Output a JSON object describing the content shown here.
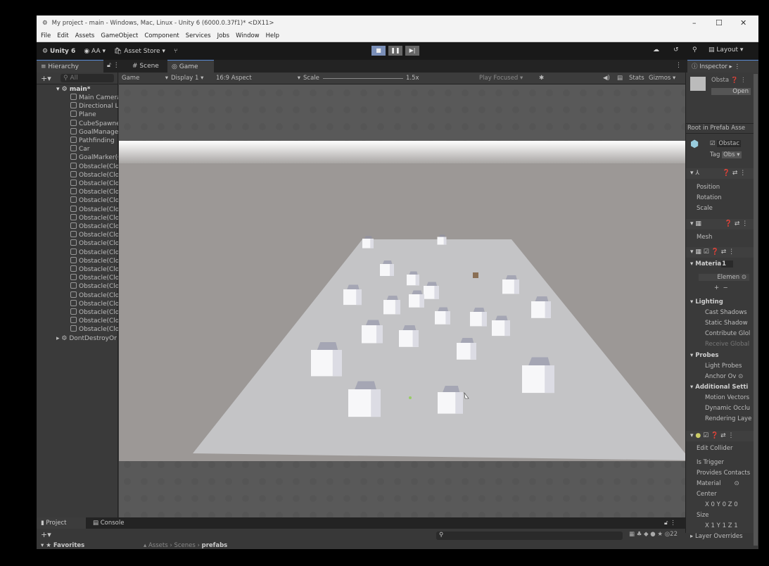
{
  "window": {
    "title": "My project - main - Windows, Mac, Linux - Unity 6 (6000.0.37f1)* <DX11>"
  },
  "menu": [
    "File",
    "Edit",
    "Assets",
    "GameObject",
    "Component",
    "Services",
    "Jobs",
    "Window",
    "Help"
  ],
  "toolbar": {
    "unity": "Unity 6",
    "account": "AA",
    "asset_store": "Asset Store",
    "layout": "Layout",
    "play_mode": "playing"
  },
  "tabs": {
    "hierarchy": "Hierarchy",
    "scene": "Scene",
    "game": "Game",
    "inspector": "Inspector"
  },
  "hierarchy": {
    "search_placeholder": "All",
    "scene": "main*",
    "items": [
      "Main Camera",
      "Directional Light",
      "Plane",
      "CubeSpawner",
      "GoalManager",
      "Pathfinding",
      "Car",
      "GoalMarker(Clone)",
      "Obstacle(Clone)",
      "Obstacle(Clone)",
      "Obstacle(Clone)",
      "Obstacle(Clone)",
      "Obstacle(Clone)",
      "Obstacle(Clone)",
      "Obstacle(Clone)",
      "Obstacle(Clone)",
      "Obstacle(Clone)",
      "Obstacle(Clone)",
      "Obstacle(Clone)",
      "Obstacle(Clone)",
      "Obstacle(Clone)",
      "Obstacle(Clone)",
      "Obstacle(Clone)",
      "Obstacle(Clone)",
      "Obstacle(Clone)",
      "Obstacle(Clone)",
      "Obstacle(Clone)",
      "Obstacle(Clone)"
    ],
    "dont_destroy": "DontDestroyOnLoad"
  },
  "game_toolbar": {
    "mode": "Game",
    "display": "Display 1",
    "aspect": "16:9 Aspect",
    "scale_label": "Scale",
    "scale_value": "1.5x",
    "play_focused": "Play Focused",
    "stats": "Stats",
    "gizmos": "Gizmos"
  },
  "inspector": {
    "object_name": "Obsta",
    "open": "Open",
    "root_prefab": "Root in Prefab Asse",
    "name_field": "Obstac",
    "tag_label": "Tag",
    "tag_value": "Obs",
    "transform": [
      "Position",
      "Rotation",
      "Scale"
    ],
    "mesh": "Mesh",
    "materials": "Materia",
    "materials_count": "1",
    "element": "Elemen",
    "lighting": "Lighting",
    "lighting_items": [
      "Cast Shadows",
      "Static Shadow",
      "Contribute Glol",
      "Receive Global"
    ],
    "probes": "Probes",
    "probe_items": [
      "Light Probes",
      "Anchor Ov"
    ],
    "additional": "Additional Setti",
    "additional_items": [
      "Motion Vectors",
      "Dynamic Occlu",
      "Rendering Laye"
    ],
    "collider": [
      "Edit Collider",
      "Is Trigger",
      "Provides Contacts",
      "Material",
      "Center"
    ],
    "center_xyz": [
      "X",
      "0",
      "Y",
      "0",
      "Z",
      "0"
    ],
    "size_label": "Size",
    "size_xyz": [
      "X",
      "1",
      "Y",
      "1",
      "Z",
      "1"
    ],
    "layer_overrides": "Layer Overrides"
  },
  "bottom": {
    "project": "Project",
    "console": "Console",
    "favorites": "Favorites",
    "breadcrumb": [
      "Assets",
      "Scenes",
      "prefabs"
    ],
    "hidden_count": "22"
  }
}
